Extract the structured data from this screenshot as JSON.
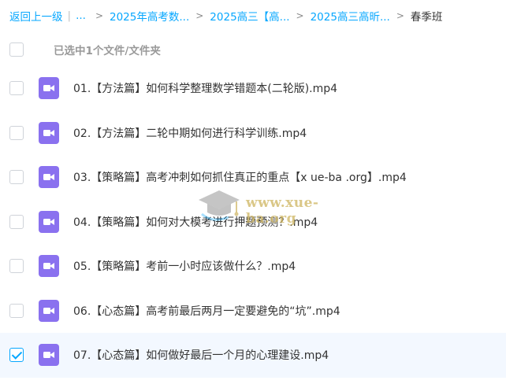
{
  "breadcrumb": {
    "back_label": "返回上一级",
    "sep_bar": "|",
    "ellipsis": "...",
    "arrow": ">",
    "items": [
      {
        "label": "2025年高考数",
        "dots": "..."
      },
      {
        "label": "2025高三【高",
        "dots": "..."
      },
      {
        "label": "2025高三高昕",
        "dots": "..."
      }
    ],
    "current": "春季班"
  },
  "selection": {
    "text": "已选中1个文件/文件夹"
  },
  "files": [
    {
      "name": "01.【方法篇】如何科学整理数学错题本(二轮版).mp4",
      "checked": false
    },
    {
      "name": "02.【方法篇】二轮中期如何进行科学训练.mp4",
      "checked": false
    },
    {
      "name": "03.【策略篇】高考冲刺如何抓住真正的重点【x ue-ba .org】.mp4",
      "checked": false
    },
    {
      "name": "04.【策略篇】如何对大模考进行押题预测？.mp4",
      "checked": false
    },
    {
      "name": "05.【策略篇】考前一小时应该做什么？.mp4",
      "checked": false
    },
    {
      "name": "06.【心态篇】高考前最后两月一定要避免的“坑”.mp4",
      "checked": false
    },
    {
      "name": "07.【心态篇】如何做好最后一个月的心理建设.mp4",
      "checked": true
    }
  ],
  "watermark": {
    "text": "www.xue-ba.org"
  },
  "colors": {
    "link": "#06a7ff",
    "video_icon": "#8a71ef",
    "selected_row": "#f3f8ff"
  },
  "icons": {
    "file": "video-file-icon",
    "watermark": "graduation-cap-icon"
  }
}
